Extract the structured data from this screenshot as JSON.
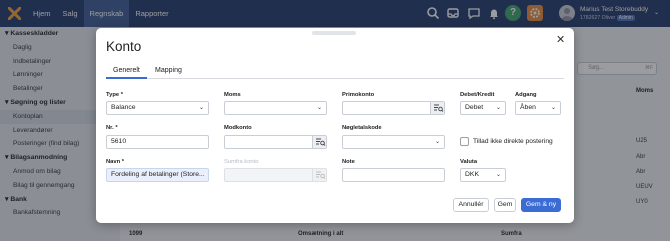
{
  "topbar": {
    "nav": [
      "Hjem",
      "Salg",
      "Regnskab",
      "Rapporter"
    ],
    "active_nav": "Regnskab",
    "help_label": "?",
    "user": {
      "name": "Marius Test Storebuddy",
      "sub": "1782627 Oliver",
      "badge": "Admin"
    }
  },
  "sidebar": {
    "sections": [
      {
        "title": "Kasseskladder",
        "items": [
          "Daglig",
          "Indbetalinger",
          "Lønninger",
          "Betalinger"
        ]
      },
      {
        "title": "Søgning og lister",
        "items": [
          "Kontoplan",
          "Leverandører",
          "Posteringer (find bilag)"
        ]
      },
      {
        "title": "Bilagsanmodning",
        "items": [
          "Anmod om bilag",
          "Bilag til gennemgang"
        ]
      },
      {
        "title": "Bank",
        "items": [
          "Bankafstemning"
        ]
      }
    ],
    "active_item": "Kontoplan"
  },
  "background": {
    "search_placeholder": "Søg...",
    "search_shortcut": "⌘F",
    "column_header": "Moms",
    "cells": [
      "U25",
      "Abr",
      "Abr",
      "UEUV",
      "UY0"
    ],
    "bottom_row": {
      "number": "1099",
      "name": "Omsætning i alt",
      "type": "Sumfra"
    }
  },
  "modal": {
    "title": "Konto",
    "tabs": [
      "Generelt",
      "Mapping"
    ],
    "active_tab": "Generelt",
    "fields": {
      "type": {
        "label": "Type *",
        "value": "Balance"
      },
      "nr": {
        "label": "Nr. *",
        "value": "5610"
      },
      "navn": {
        "label": "Navn *",
        "value": "Fordeling af betalinger (Store..."
      },
      "moms": {
        "label": "Moms",
        "value": ""
      },
      "modkonto": {
        "label": "Modkonto",
        "value": ""
      },
      "sumfra": {
        "label": "Sumfra konto",
        "value": ""
      },
      "primokonto": {
        "label": "Primokonto",
        "value": ""
      },
      "noegletalskode": {
        "label": "Nøgletalskode",
        "value": ""
      },
      "note": {
        "label": "Note",
        "value": ""
      },
      "debet_kredit": {
        "label": "Debet/Kredit",
        "value": "Debet"
      },
      "adgang": {
        "label": "Adgang",
        "value": "Åben"
      },
      "valuta": {
        "label": "Valuta",
        "value": "DKK"
      }
    },
    "checkbox_label": "Tillad ikke direkte postering",
    "checkbox_checked": false,
    "buttons": {
      "cancel": "Annullér",
      "save": "Gem",
      "save_new": "Gem & ny"
    }
  }
}
